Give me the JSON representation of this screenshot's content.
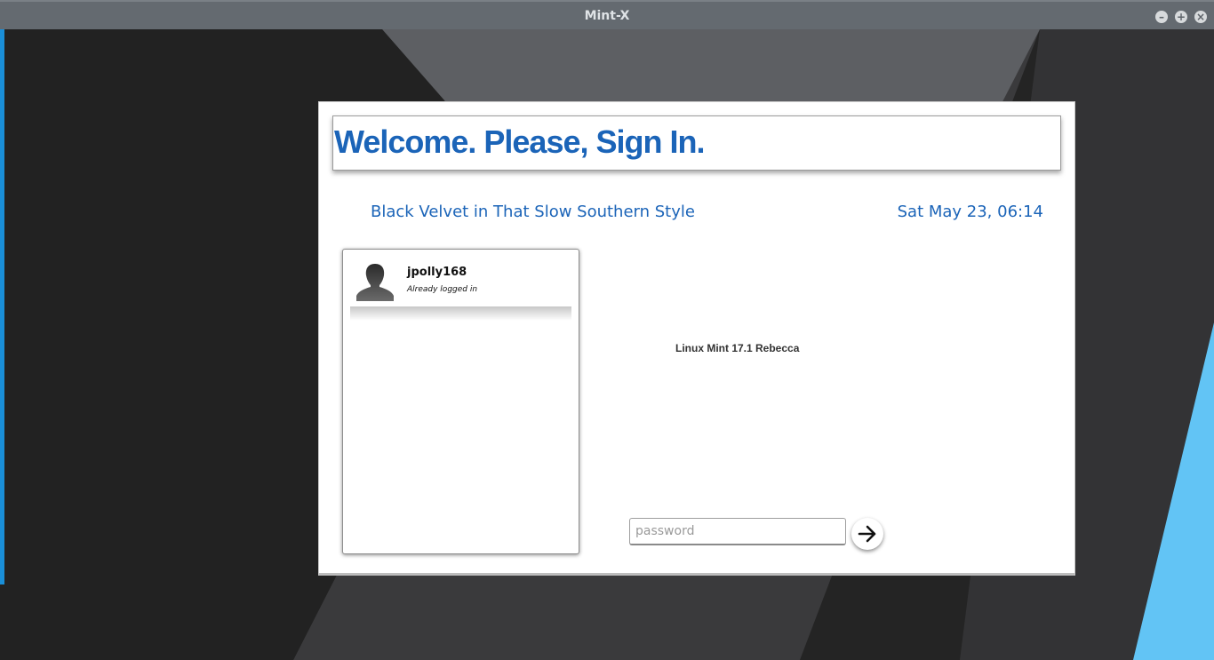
{
  "window": {
    "title": "Mint-X",
    "controls": {
      "minimize": "–",
      "maximize": "+",
      "close": "×"
    }
  },
  "greeter": {
    "welcome": "Welcome. Please, Sign In.",
    "subtitle": "Black Velvet in That Slow Southern Style",
    "datetime": "Sat May 23, 06:14",
    "os_label": "Linux Mint 17.1 Rebecca",
    "users": [
      {
        "name": "jpolly168",
        "status": "Already logged in",
        "icon": "user-avatar-icon"
      }
    ],
    "password": {
      "placeholder": "password",
      "value": ""
    },
    "login_icon": "arrow-right-icon"
  },
  "colors": {
    "accent": "#1b64b8",
    "titlebar": "#646a70",
    "desktop_dark": "#232323",
    "desktop_blue": "#62c4f5"
  }
}
